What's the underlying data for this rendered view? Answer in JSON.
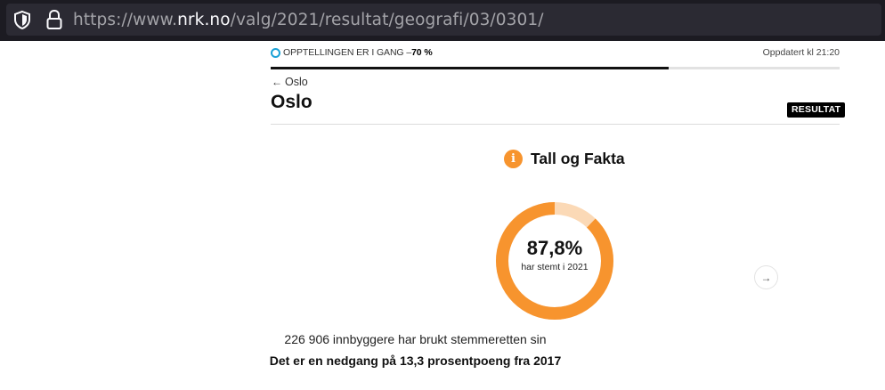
{
  "browser": {
    "url_prefix": "https://www.",
    "url_host": "nrk.no",
    "url_path": "/valg/2021/resultat/geografi/03/0301/"
  },
  "status": {
    "label": "OPPTELLINGEN ER I GANG –",
    "percent_text": "70 %",
    "progress_fraction": 0.7,
    "updated": "Oppdatert kl 21:20",
    "ring_color": "#1aa1d6"
  },
  "nav": {
    "back_label": "Oslo"
  },
  "page": {
    "title": "Oslo",
    "badge": "RESULTAT"
  },
  "facts": {
    "title": "Tall og Fakta",
    "info_icon_glyph": "i",
    "accent_color": "#f7942e",
    "accent_light": "#fbd9b6",
    "donut": {
      "value_text": "87,8%",
      "fraction": 0.878,
      "label": "har stemt i 2021"
    },
    "line1": "226 906 innbyggere har brukt stemmeretten sin",
    "line2": "Det er en nedgang på 13,3 prosentpoeng fra 2017",
    "next_icon": "→"
  }
}
